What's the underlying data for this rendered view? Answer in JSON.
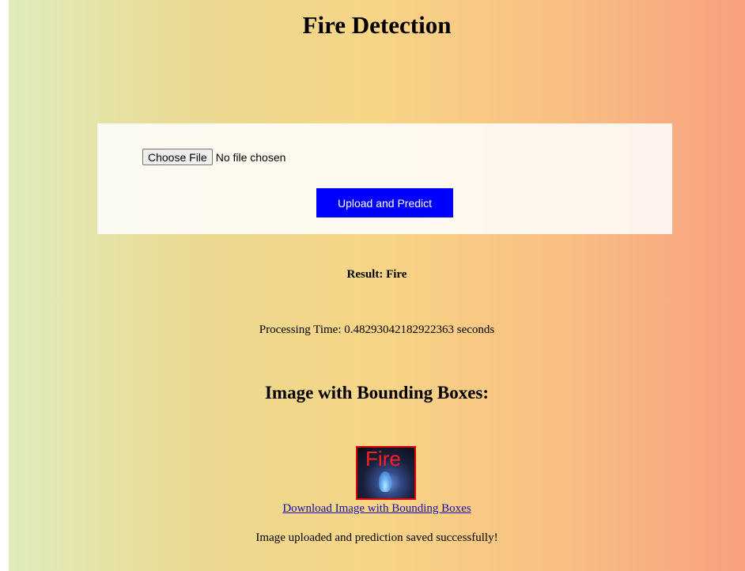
{
  "page": {
    "title": "Fire Detection"
  },
  "upload": {
    "choose_file_label": "Choose File",
    "file_status": "No file chosen",
    "predict_button_label": "Upload and Predict"
  },
  "result": {
    "text": "Result: Fire",
    "processing_time": "Processing Time: 0.48293042182922363 seconds"
  },
  "image_section": {
    "heading": "Image with Bounding Boxes:",
    "thumbnail_label": "Fire",
    "download_link_text": "Download Image with Bounding Boxes"
  },
  "status": {
    "success_message": "Image uploaded and prediction saved successfully!"
  },
  "colors": {
    "predict_button": "#0000ff",
    "bounding_box": "#e00000",
    "link": "#1a0dab"
  }
}
